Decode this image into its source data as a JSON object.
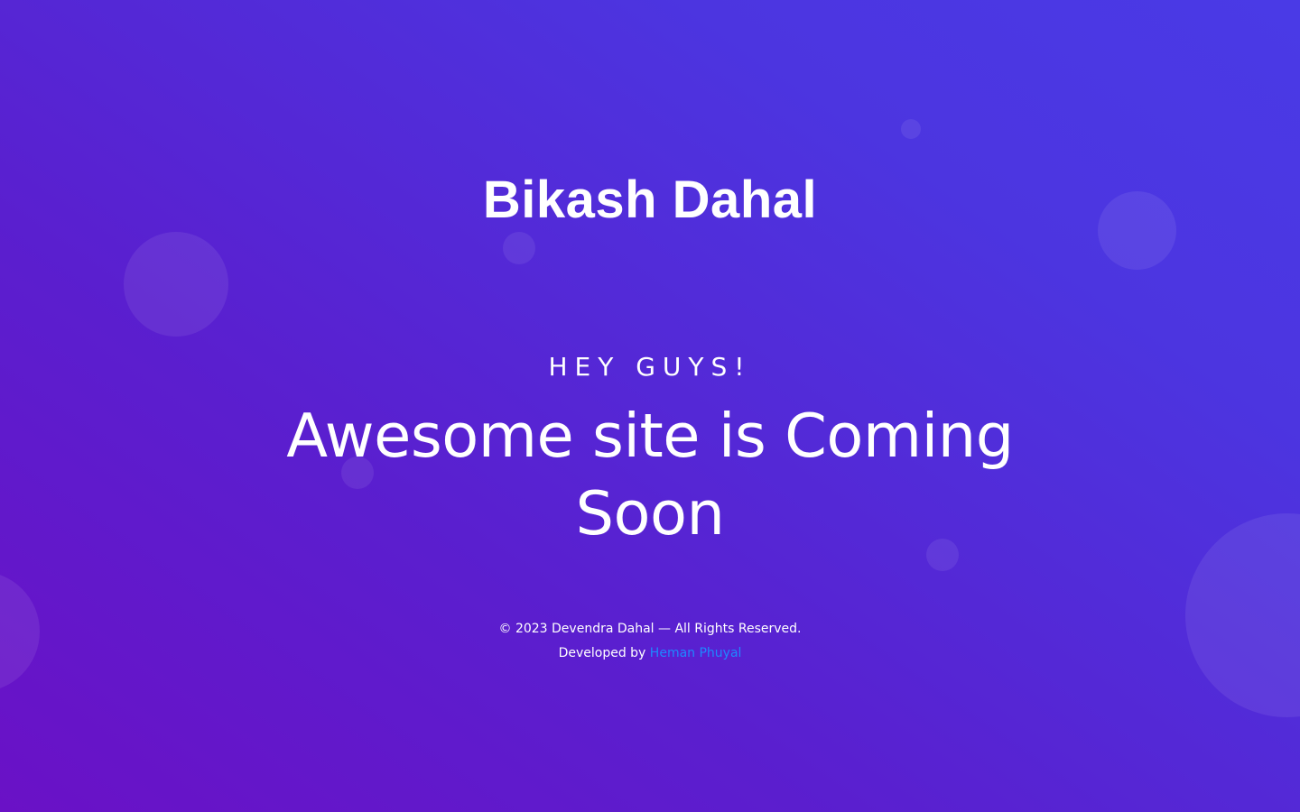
{
  "colors": {
    "background_start": "#6a11c6",
    "background_end": "#4a3ae3",
    "accent_link": "#1e88ff",
    "text": "#ffffff"
  },
  "logo": {
    "text": "Bikash Dahal"
  },
  "hero": {
    "eyebrow": "HEY GUYS!",
    "headline": "Awesome site is Coming Soon"
  },
  "footer": {
    "copyright": "© 2023 Devendra Dahal — All Rights Reserved.",
    "developed_by_prefix": "Developed by",
    "developer_link_text": "Heman Phuyal"
  }
}
